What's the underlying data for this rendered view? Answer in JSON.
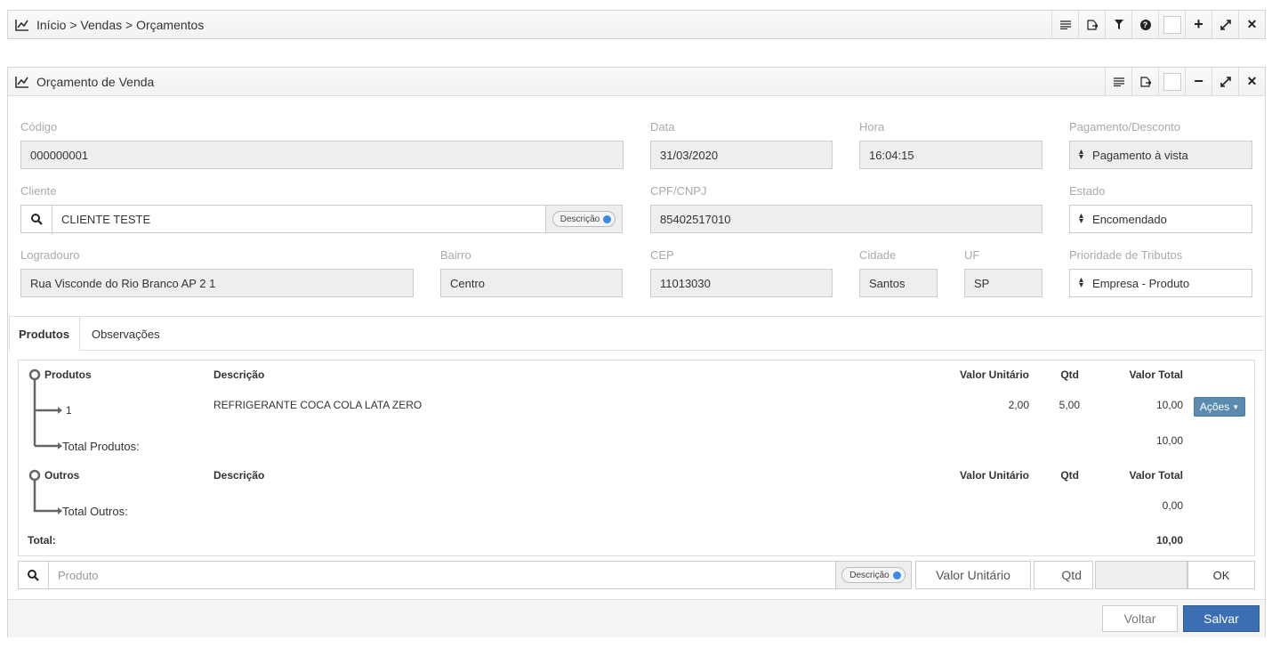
{
  "breadcrumb_panel": {
    "title": "Início > Vendas > Orçamentos"
  },
  "form_panel": {
    "title": "Orçamento de Venda"
  },
  "fields": {
    "codigo": {
      "label": "Código",
      "value": "000000001"
    },
    "data": {
      "label": "Data",
      "value": "31/03/2020"
    },
    "hora": {
      "label": "Hora",
      "value": "16:04:15"
    },
    "pagamento": {
      "label": "Pagamento/Desconto",
      "value": "Pagamento à vista"
    },
    "cliente": {
      "label": "Cliente",
      "value": "CLIENTE TESTE",
      "toggle": "Descrição"
    },
    "cpf": {
      "label": "CPF/CNPJ",
      "value": "85402517010"
    },
    "estado": {
      "label": "Estado",
      "value": "Encomendado"
    },
    "logradouro": {
      "label": "Logradouro",
      "value": "Rua Visconde do Rio Branco AP 2 1"
    },
    "bairro": {
      "label": "Bairro",
      "value": "Centro"
    },
    "cep": {
      "label": "CEP",
      "value": "11013030"
    },
    "cidade": {
      "label": "Cidade",
      "value": "Santos"
    },
    "uf": {
      "label": "UF",
      "value": "SP"
    },
    "prioridade": {
      "label": "Prioridade de Tributos",
      "value": "Empresa - Produto"
    }
  },
  "tabs": [
    "Produtos",
    "Observações"
  ],
  "grid": {
    "headers": {
      "group": "Produtos",
      "desc": "Descrição",
      "unit": "Valor Unitário",
      "qtd": "Qtd",
      "total": "Valor Total"
    },
    "rows": [
      {
        "item": "1",
        "desc": "REFRIGERANTE COCA COLA LATA ZERO",
        "unit": "2,00",
        "qtd": "5,00",
        "total": "10,00",
        "action": "Ações"
      }
    ],
    "total_produtos_label": "Total Produtos:",
    "total_produtos": "10,00",
    "outros_headers": {
      "group": "Outros",
      "desc": "Descrição",
      "unit": "Valor Unitário",
      "qtd": "Qtd",
      "total": "Valor Total"
    },
    "total_outros_label": "Total Outros:",
    "total_outros": "0,00",
    "total_label": "Total:",
    "total": "10,00"
  },
  "add_bar": {
    "produto_placeholder": "Produto",
    "toggle": "Descrição",
    "valor_placeholder": "Valor Unitário",
    "qtd_placeholder": "Qtd",
    "ok_label": "OK"
  },
  "footer": {
    "voltar": "Voltar",
    "salvar": "Salvar"
  },
  "colors": {
    "primary": "#3c6eb4",
    "action": "#5b8cb0",
    "toggle_dot": "#3b8ae6"
  }
}
